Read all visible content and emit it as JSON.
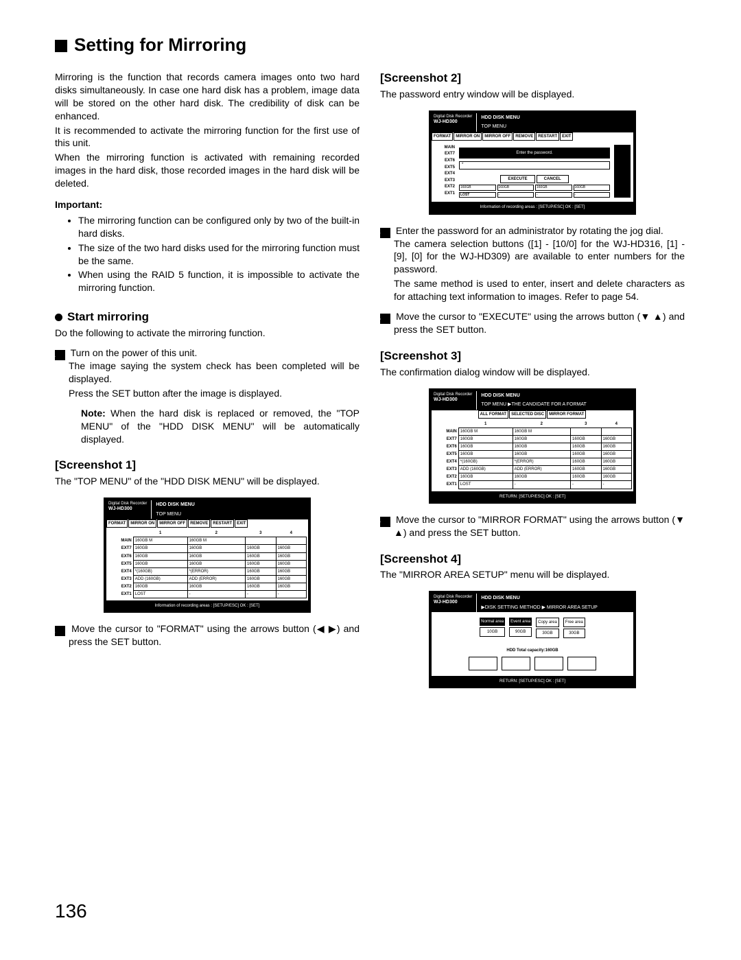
{
  "page_number": "136",
  "title": "Setting for Mirroring",
  "intro": {
    "p1": "Mirroring is the function that records camera images onto two hard disks simultaneously. In case one hard disk has a problem, image data will be stored on the other hard disk. The credibility of disk can be enhanced.",
    "p2": "It is recommended to activate the mirroring function for the first use of this unit.",
    "p3": "When the mirroring function is activated with remaining recorded images in the hard disk, those recorded images in the hard disk will be deleted."
  },
  "important_label": "Important:",
  "important_bullets": [
    "The mirroring function can be configured only by two of the built-in hard disks.",
    "The size of the two hard disks used for the mirroring function must be the same.",
    "When using the RAID 5 function, it is impossible to activate the mirroring function."
  ],
  "start_heading": "Start mirroring",
  "start_lead": "Do the following to activate the mirroring function.",
  "step1_a": "Turn on the power of this unit.",
  "step1_b": "The image saying the system check has been completed will be displayed.",
  "step1_c": "Press the SET button after the image is displayed.",
  "note_label": "Note:",
  "note_text": "When the hard disk is replaced or removed, the \"TOP MENU\" of the \"HDD DISK MENU\" will be automatically displayed.",
  "sshot1_head": "[Screenshot 1]",
  "sshot1_lead": "The \"TOP MENU\" of the \"HDD DISK MENU\" will be displayed.",
  "step2": "Move the cursor to \"FORMAT\" using the arrows button (◀ ▶) and press the SET button.",
  "sshot2_head": "[Screenshot 2]",
  "sshot2_lead": "The password entry window will be displayed.",
  "step3_a": "Enter the password for an administrator by rotating the jog dial.",
  "step3_b": "The camera selection buttons ([1] - [10/0] for the WJ-HD316, [1] - [9], [0] for the WJ-HD309) are available to enter numbers for the password.",
  "step3_c": "The same method is used to enter, insert and delete characters as for attaching text information to images. Refer to page 54.",
  "step4": "Move the cursor to \"EXECUTE\" using the arrows button (▼ ▲) and press the SET button.",
  "sshot3_head": "[Screenshot 3]",
  "sshot3_lead": "The confirmation dialog window will be displayed.",
  "step5": "Move the cursor to \"MIRROR FORMAT\" using the arrows button (▼ ▲) and press the SET button.",
  "sshot4_head": "[Screenshot 4]",
  "sshot4_lead": "The \"MIRROR AREA SETUP\" menu will be displayed.",
  "shot_common": {
    "recorder_label": "Digital Disk Recorder",
    "model": "WJ-HD300",
    "menu_title": "HDD DISK MENU",
    "top_menu": "TOP MENU",
    "buttons": [
      "FORMAT",
      "MIRROR ON",
      "MIRROR OFF",
      "REMOVE",
      "RESTART",
      "EXIT"
    ],
    "footer": "Information of recording areas : [SETUP/ESC] OK : [SET]",
    "return_footer": "RETURN: [SETUP/ESC] OK : [SET]"
  },
  "shot1": {
    "cols": [
      "1",
      "2",
      "3",
      "4"
    ],
    "rows": [
      {
        "label": "MAIN",
        "c": [
          "160GB M",
          "160GB M",
          "",
          ""
        ]
      },
      {
        "label": "EXT7",
        "c": [
          "160GB",
          "160GB",
          "160GB",
          "160GB"
        ]
      },
      {
        "label": "EXT6",
        "c": [
          "160GB",
          "160GB",
          "160GB",
          "160GB"
        ]
      },
      {
        "label": "EXT5",
        "c": [
          "160GB",
          "160GB",
          "160GB",
          "160GB"
        ]
      },
      {
        "label": "EXT4",
        "c": [
          "*(160GB)",
          "*(ERROR)",
          "160GB",
          "160GB"
        ]
      },
      {
        "label": "EXT3",
        "c": [
          "ADD (160GB)",
          "ADD (ERROR)",
          "160GB",
          "160GB"
        ]
      },
      {
        "label": "EXT2",
        "c": [
          "160GB",
          "160GB",
          "160GB",
          "160GB"
        ]
      },
      {
        "label": "EXT1",
        "c": [
          "LOST",
          "-",
          "-",
          "-"
        ]
      }
    ]
  },
  "shot2": {
    "labels": [
      "MAIN",
      "EXT7",
      "EXT6",
      "EXT5",
      "EXT4",
      "EXT3",
      "EXT2",
      "EXT1"
    ],
    "prompt": "Enter the password.",
    "input_masked": "*",
    "btn_exec": "EXECUTE",
    "btn_cancel": "CANCEL",
    "bottom_tiny": [
      "160GB",
      "160GB",
      "160GB",
      "160GB"
    ],
    "lost": "LOST"
  },
  "shot3": {
    "breadcrumb": "TOP MENU ▶THE CANDIDATE FOR A FORMAT",
    "tabs": [
      "ALL FORMAT",
      "SELECTED DISC",
      "MIRROR FORMAT"
    ],
    "cols": [
      "1",
      "2",
      "3",
      "4"
    ],
    "rows": [
      {
        "label": "MAIN",
        "c": [
          "160GB M",
          "160GB M",
          "",
          ""
        ]
      },
      {
        "label": "EXT7",
        "c": [
          "160GB",
          "160GB",
          "160GB",
          "160GB"
        ]
      },
      {
        "label": "EXT6",
        "c": [
          "160GB",
          "160GB",
          "160GB",
          "160GB"
        ]
      },
      {
        "label": "EXT5",
        "c": [
          "160GB",
          "160GB",
          "160GB",
          "160GB"
        ]
      },
      {
        "label": "EXT4",
        "c": [
          "*(160GB)",
          "*(ERROR)",
          "160GB",
          "160GB"
        ]
      },
      {
        "label": "EXT3",
        "c": [
          "ADD (160GB)",
          "ADD (ERROR)",
          "160GB",
          "160GB"
        ]
      },
      {
        "label": "EXT2",
        "c": [
          "160GB",
          "160GB",
          "160GB",
          "160GB"
        ]
      },
      {
        "label": "EXT1",
        "c": [
          "LOST",
          "-",
          "-",
          "-"
        ]
      }
    ]
  },
  "shot4": {
    "breadcrumb": "▶DISK SETTING METHOD ▶ MIRROR AREA SETUP",
    "areas": [
      {
        "label": "Normal area",
        "val": "10GB"
      },
      {
        "label": "Event area",
        "val": "90GB"
      },
      {
        "label": "Copy area",
        "val": "30GB"
      },
      {
        "label": "Free area",
        "val": "30GB"
      }
    ],
    "total": "HDD Total capacity:160GB"
  }
}
